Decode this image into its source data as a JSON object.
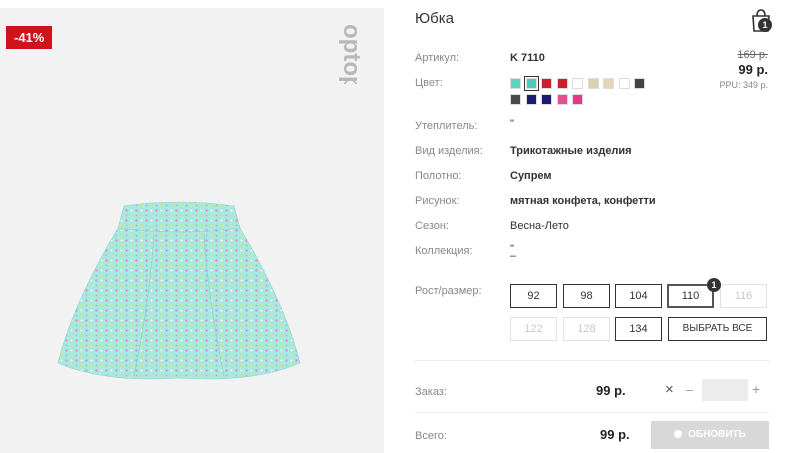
{
  "product": {
    "title": "Юбка",
    "discount": "-41%",
    "old_price": "169 р.",
    "price": "99 р.",
    "ppu": "PPU: 349 р."
  },
  "cart": {
    "count": "1"
  },
  "attributes": [
    {
      "label": "Артикул:",
      "value": "K 7110",
      "bold": true
    },
    {
      "label": "Цвет:",
      "value": ""
    },
    {
      "label": "Утеплитель:",
      "value": "\"",
      "bold": false
    },
    {
      "label": "Вид изделия:",
      "value": "Трикотажные изделия",
      "bold": true
    },
    {
      "label": "Полотно:",
      "value": "Супрем",
      "bold": true
    },
    {
      "label": "Рисунок:",
      "value": "мятная конфета, конфетти",
      "bold": true
    },
    {
      "label": "Сезон:",
      "value": "Весна-Лето",
      "bold": false
    },
    {
      "label": "Коллекция:",
      "value": "\"",
      "bold": false
    }
  ],
  "colors": {
    "row1": [
      "#5fd2c1",
      "#4ecbb7",
      "#c8202a",
      "#c8202a",
      "#ffffff",
      "#dcd0b2",
      "#e2d6b8",
      "#ffffff",
      "#444444"
    ],
    "row2": [
      "#4a4a4a",
      "#1c1c6e",
      "#1c1c6e",
      "#e84c8f",
      "#e8368a"
    ],
    "selected_index": 1
  },
  "sizes": {
    "label": "Рост/размер:",
    "row1": [
      {
        "size": "92",
        "state": "available"
      },
      {
        "size": "98",
        "state": "available"
      },
      {
        "size": "104",
        "state": "available"
      },
      {
        "size": "110",
        "state": "selected"
      },
      {
        "size": "116",
        "state": "disabled"
      }
    ],
    "row2": [
      {
        "size": "122",
        "state": "disabled"
      },
      {
        "size": "128",
        "state": "disabled"
      },
      {
        "size": "134",
        "state": "available"
      }
    ],
    "selected_badge": "1",
    "select_all": "ВЫБРАТЬ ВСЕ"
  },
  "order": {
    "label": "Заказ:",
    "price": "99 р.",
    "times": "×",
    "minus": "–",
    "plus": "+",
    "qty": ""
  },
  "total": {
    "label": "Всего:",
    "price": "99 р.",
    "update_button": "ОБНОВИТЬ"
  },
  "brand": {
    "logo_text": "optop"
  },
  "colors_ui": {
    "accent_red": "#d0121b",
    "button_gray": "#d8d8d8"
  }
}
